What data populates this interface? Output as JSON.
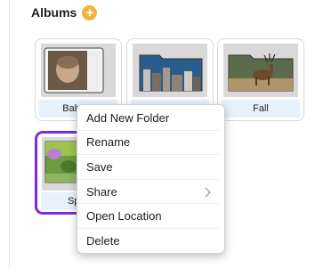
{
  "albums": {
    "title": "Albums",
    "add_icon": "plus-icon",
    "accent_color": "#f1b53c",
    "selected_color": "#7d2ae8",
    "cards": [
      {
        "label": "Baby Pictures",
        "visible_label": "Baby P"
      },
      {
        "label": "City",
        "visible_label": ""
      },
      {
        "label": "Fall",
        "visible_label": "Fall"
      },
      {
        "label": "Spring",
        "visible_label": "Spr"
      }
    ]
  },
  "context_menu": {
    "items": [
      {
        "label": "Add New Folder"
      },
      {
        "label": "Rename"
      },
      {
        "label": "Save"
      },
      {
        "label": "Share",
        "icon": "chevron-right-icon"
      },
      {
        "label": "Open Location"
      },
      {
        "label": "Delete"
      }
    ]
  }
}
